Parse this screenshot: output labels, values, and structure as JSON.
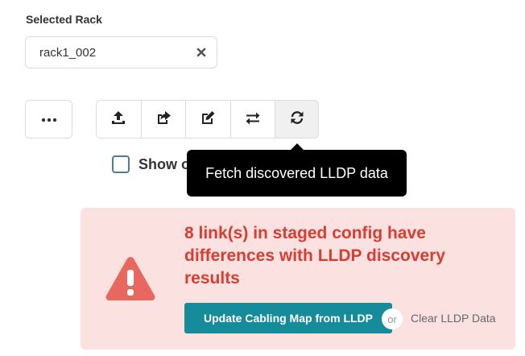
{
  "selected_rack": {
    "label": "Selected Rack",
    "value": "rack1_002"
  },
  "toolbar": {
    "more_icon": "ellipsis-icon",
    "buttons": [
      {
        "icon": "upload-icon"
      },
      {
        "icon": "share-icon"
      },
      {
        "icon": "edit-icon"
      },
      {
        "icon": "swap-arrows-icon"
      },
      {
        "icon": "refresh-icon"
      }
    ]
  },
  "checkbox": {
    "label": "Show o",
    "checked": false
  },
  "tooltip": {
    "text": "Fetch discovered LLDP data"
  },
  "alert": {
    "message": "8 link(s) in staged config have differences with LLDP discovery results",
    "update_button": "Update Cabling Map from LLDP",
    "or_text": "or",
    "clear_link": "Clear LLDP Data",
    "colors": {
      "background": "#fbe2e1",
      "text": "#d93d31",
      "icon": "#e8685f",
      "button": "#168b9a"
    }
  }
}
